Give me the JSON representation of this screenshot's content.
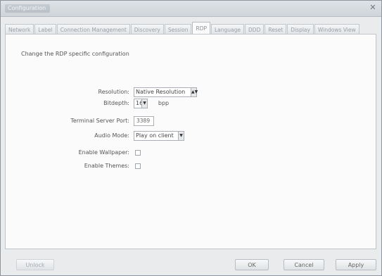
{
  "window": {
    "title": "Configuration",
    "close_icon": "close-icon"
  },
  "tabs": [
    {
      "label": "Network"
    },
    {
      "label": "Label"
    },
    {
      "label": "Connection Management"
    },
    {
      "label": "Discovery"
    },
    {
      "label": "Session"
    },
    {
      "label": "RDP"
    },
    {
      "label": "Language"
    },
    {
      "label": "DDD"
    },
    {
      "label": "Reset"
    },
    {
      "label": "Display"
    },
    {
      "label": "Windows View"
    }
  ],
  "active_tab": "RDP",
  "panel": {
    "description": "Change the RDP specific configuration",
    "resolution": {
      "label": "Resolution:",
      "value": "Native Resolution"
    },
    "bitdepth": {
      "label": "Bitdepth:",
      "value": "16",
      "unit": "bpp"
    },
    "port": {
      "label": "Terminal Server Port:",
      "value": "3389"
    },
    "audio": {
      "label": "Audio Mode:",
      "value": "Play on client"
    },
    "wallpaper": {
      "label": "Enable Wallpaper:",
      "checked": false
    },
    "themes": {
      "label": "Enable Themes:",
      "checked": false
    }
  },
  "buttons": {
    "unlock": "Unlock",
    "ok": "OK",
    "cancel": "Cancel",
    "apply": "Apply"
  }
}
